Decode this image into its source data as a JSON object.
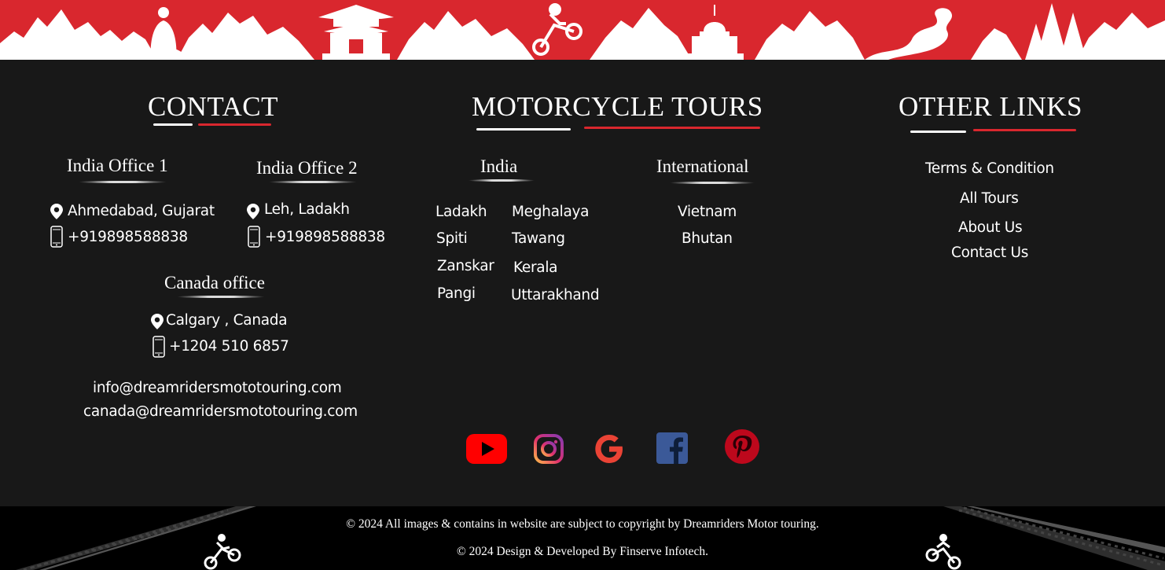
{
  "banner": {
    "icon_names": [
      "mountain-range-icon",
      "buddha-icon",
      "pagoda-icon",
      "motocross-rider-icon",
      "stupa-icon",
      "dragon-icon",
      "pine-trees-icon"
    ],
    "color": "#d9272e"
  },
  "contact": {
    "title": "CONTACT",
    "office1": {
      "title": "India Office 1",
      "location": "Ahmedabad, Gujarat",
      "phone": "+919898588838"
    },
    "office2": {
      "title": "India Office 2",
      "location": "Leh, Ladakh",
      "phone": "+919898588838"
    },
    "canada": {
      "title": "Canada office",
      "location": "Calgary , Canada",
      "phone": "+1204 510 6857"
    },
    "emails": [
      "info@dreamridersmototouring.com",
      "canada@dreamridersmototouring.com"
    ]
  },
  "tours": {
    "title": "MOTORCYCLE TOURS",
    "india_title": "India",
    "india": [
      "Ladakh",
      "Meghalaya",
      "Spiti",
      "Tawang",
      "Zanskar",
      "Kerala",
      "Pangi",
      "Uttarakhand"
    ],
    "international_title": "International",
    "international": [
      "Vietnam",
      "Bhutan"
    ]
  },
  "other": {
    "title": "OTHER LINKS",
    "links": [
      "Terms & Condition",
      "All Tours",
      "About Us",
      "Contact Us"
    ]
  },
  "social": [
    "youtube-icon",
    "instagram-icon",
    "google-icon",
    "facebook-icon",
    "pinterest-icon"
  ],
  "footer": {
    "copyright": "© 2024 All images & contains in website are subject to copyright by Dreamriders Motor touring.",
    "developer": "© 2024 Design & Developed By Finserve Infotech."
  },
  "colors": {
    "accent": "#d9272e",
    "background": "#181818",
    "footer": "#000000"
  }
}
